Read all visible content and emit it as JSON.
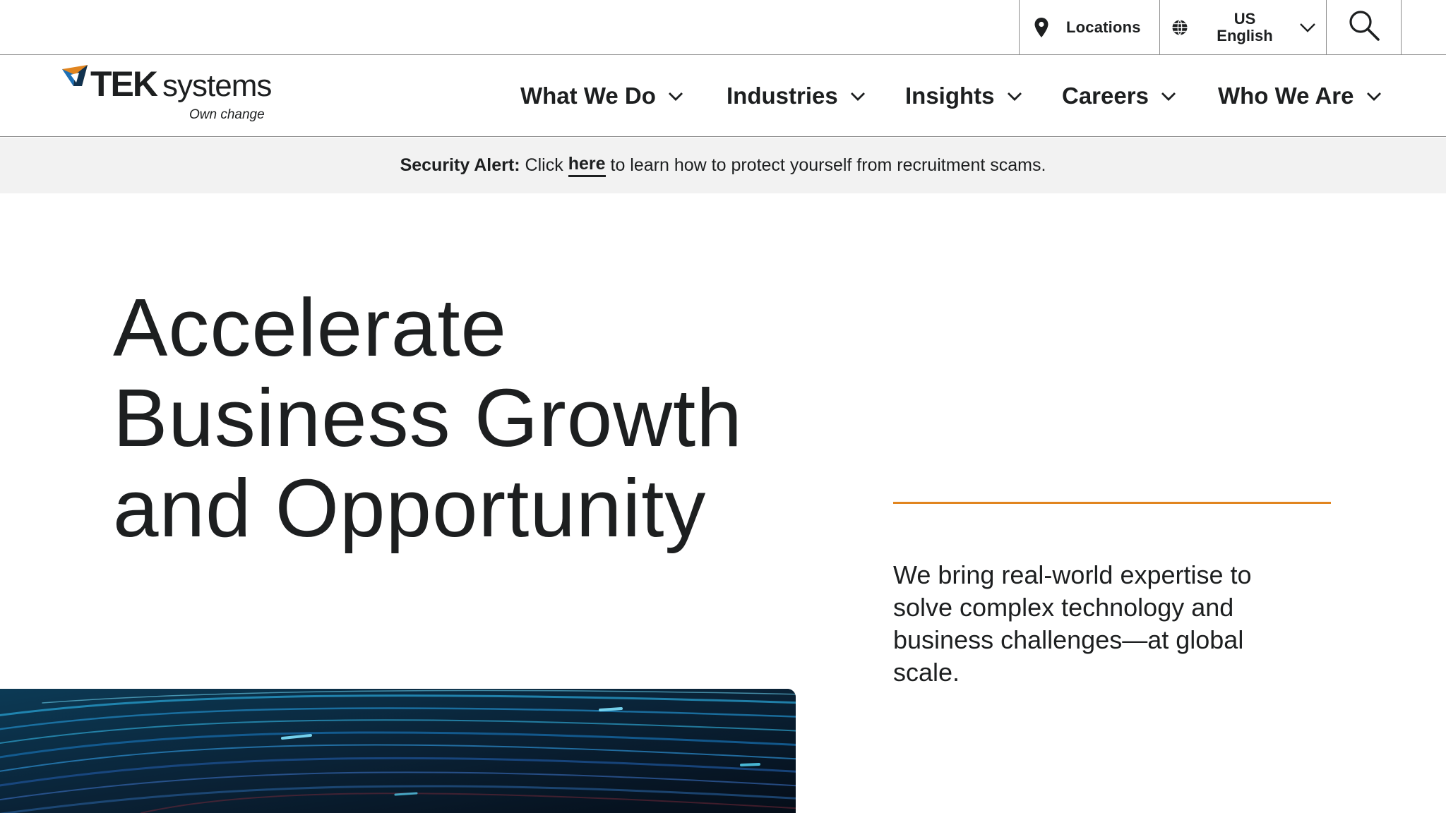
{
  "utility": {
    "locations_label": "Locations",
    "region": "US",
    "language": "English"
  },
  "brand": {
    "logo_text_bold": "TEK",
    "logo_text_light": "systems",
    "tagline": "Own change",
    "accent_color": "#e1851f",
    "logo_blue": "#1c6fb5"
  },
  "nav": {
    "items": [
      {
        "label": "What We Do"
      },
      {
        "label": "Industries"
      },
      {
        "label": "Insights"
      },
      {
        "label": "Careers"
      },
      {
        "label": "Who We Are"
      }
    ]
  },
  "alert": {
    "prefix": "Security Alert:",
    "click": "Click",
    "link": "here",
    "suffix": "to learn how to protect yourself from recruitment scams."
  },
  "hero": {
    "title_lines": [
      "Accelerate",
      "Business Growth",
      "and Opportunity"
    ],
    "description": "We bring real-world expertise to solve complex technology and business challenges—at global scale."
  },
  "icons": {
    "pin": "location-pin-icon",
    "globe": "globe-icon",
    "chevron": "chevron-down-icon",
    "search": "search-icon"
  }
}
